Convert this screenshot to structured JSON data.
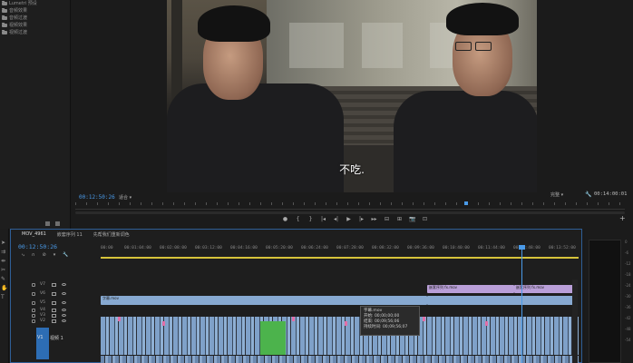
{
  "effects_panel": {
    "items": [
      "Lumetri 预设",
      "音频效果",
      "音频过渡",
      "视频效果",
      "视频过渡"
    ]
  },
  "program": {
    "subtitle": "不吃.",
    "timecode": "00:12:50:26",
    "fit": "适合",
    "quality": "完整",
    "duration": "00:14:00:01",
    "transport": [
      "●",
      "{",
      "}",
      "|◂",
      "◂|",
      "▶",
      "|▸",
      "▸▸",
      "⊟",
      "⊞",
      "📷",
      "⊡"
    ],
    "add_button": "+"
  },
  "timeline": {
    "tabs": [
      "MOV_4961",
      "嵌套序列 11",
      "先帮我们重新调色"
    ],
    "timecode": "00:12:50:26",
    "ruler_ticks": [
      "00:00",
      "00:01:04:00",
      "00:02:08:00",
      "00:03:12:00",
      "00:04:16:00",
      "00:05:20:00",
      "00:06:24:00",
      "00:07:28:00",
      "00:08:32:00",
      "00:09:36:00",
      "00:10:40:00",
      "00:11:44:00",
      "00:12:48:00",
      "00:13:52:00"
    ],
    "tracks": [
      "V7",
      "V6",
      "V5",
      "V4",
      "V3",
      "V2",
      "V1"
    ],
    "v1_label": "视频 1",
    "v1_tag": "V1",
    "clips": {
      "purple_1": "嵌套序列 fx.mov",
      "purple_2": "嵌套序列 fx.mov",
      "blue_long": "字幕.mov"
    },
    "tooltip": {
      "name": "字幕.mov",
      "start": "开始: 00;00;00;00",
      "end": "结束: 00;09;56;06",
      "duration": "持续时间: 00;09;56;07"
    }
  },
  "audio_meter": {
    "db_labels": [
      "0",
      "-6",
      "-12",
      "-18",
      "-24",
      "-30",
      "-36",
      "-42",
      "-48",
      "-54"
    ]
  },
  "colors": {
    "accent_blue": "#4a9ae8",
    "clip_purple": "#b99fd8",
    "clip_blue": "#87a9d1",
    "clip_green": "#4cb34c",
    "work_area": "#d6c33a"
  }
}
